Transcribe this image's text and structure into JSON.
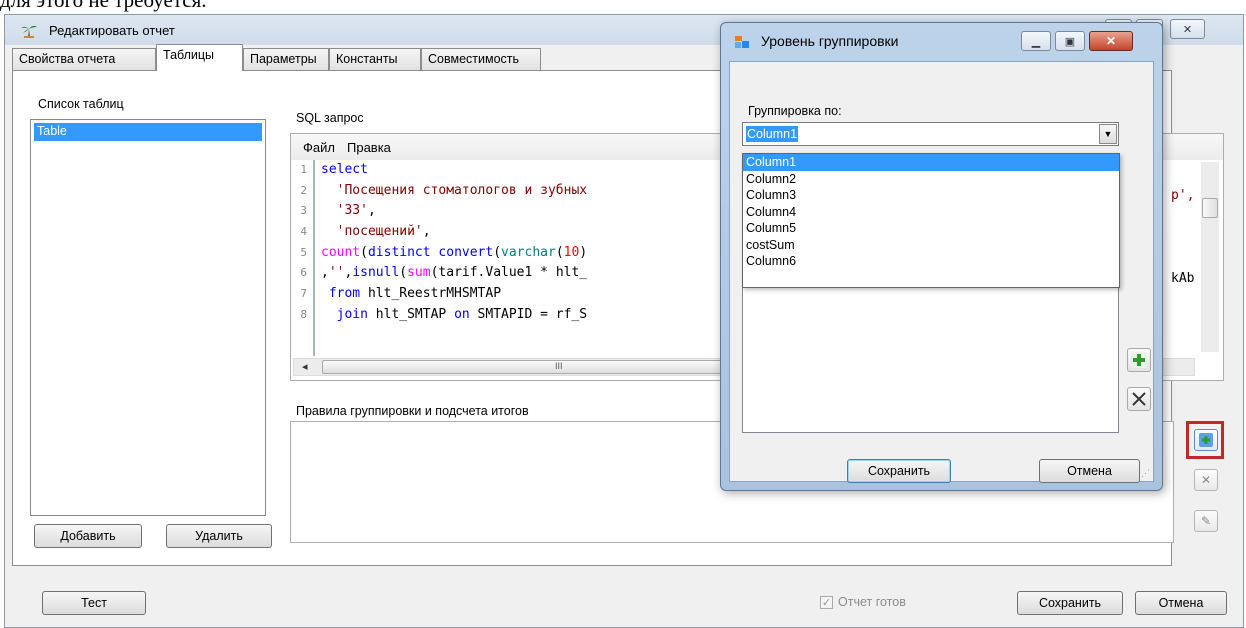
{
  "doc_text": "для этого не требуется.",
  "main_window": {
    "title": "Редактировать отчет",
    "tabs": [
      {
        "label": "Свойства отчета",
        "active": false
      },
      {
        "label": "Таблицы",
        "active": true
      },
      {
        "label": "Параметры",
        "active": false
      },
      {
        "label": "Константы",
        "active": false
      },
      {
        "label": "Совместимость",
        "active": false
      }
    ],
    "tables_label": "Список таблиц",
    "tables": [
      "Table"
    ],
    "add_button": "Добавить",
    "delete_button": "Удалить",
    "sql_label": "SQL запрос",
    "sql_menu": {
      "file": "Файл",
      "edit": "Правка"
    },
    "sql_line_numbers": [
      "1",
      "2",
      "3",
      "4",
      "5",
      "6",
      "7",
      "8"
    ],
    "sql_right_fragments": [
      "p',",
      "kAb"
    ],
    "scroll_grip": "III",
    "rules_label": "Правила группировки и подсчета итогов",
    "test_button": "Тест",
    "ready_checkbox": {
      "label": "Отчет готов",
      "checked": true,
      "enabled": false
    },
    "save_button": "Сохранить",
    "cancel_button": "Отмена"
  },
  "dialog": {
    "title": "Уровень группировки",
    "group_by_label": "Группировка по:",
    "selected": "Column1",
    "options": [
      "Column1",
      "Column2",
      "Column3",
      "Column4",
      "Column5",
      "costSum",
      "Column6"
    ],
    "save_button": "Сохранить",
    "cancel_button": "Отмена"
  },
  "colors": {
    "selection": "#3399ff",
    "keyword": "#0000ff",
    "function": "#ff00ff",
    "type": "#008080",
    "string": "#800000",
    "number": "#ff0000",
    "highlight_frame": "#c0282a"
  }
}
